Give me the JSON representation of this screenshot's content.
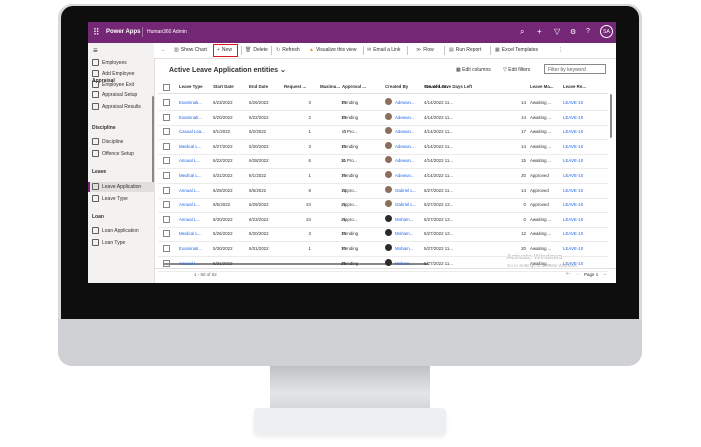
{
  "topbar": {
    "app_name": "Power Apps",
    "environment": "Human360 Admin",
    "avatar_initials": "SA",
    "icons": [
      "waffle-icon",
      "search-icon",
      "plus-icon",
      "filter-icon",
      "settings-icon",
      "help-icon"
    ]
  },
  "sidebar": {
    "groups": [
      {
        "items": [
          "Employees",
          "Add Employee",
          "Employee Exit"
        ]
      },
      {
        "heading": "Appraisal",
        "items": [
          "Appraisal Setup",
          "Appraisal Results"
        ]
      },
      {
        "heading": "Discipline",
        "items": [
          "Discipline",
          "Offence Setup"
        ]
      },
      {
        "heading": "Leave",
        "items": [
          "Leave Application",
          "Leave Type"
        ]
      },
      {
        "heading": "Loan",
        "items": [
          "Loan Application",
          "Loan Type"
        ]
      }
    ],
    "active_item": "Leave Application"
  },
  "commandbar": {
    "back": "←",
    "show_chart": "Show Chart",
    "new": "New",
    "delete": "Delete",
    "refresh": "Refresh",
    "visualize": "Visualize this view",
    "email_link": "Email a Link",
    "flow": "Flow",
    "run_report": "Run Report",
    "excel_templates": "Excel Templates",
    "more": "⋮"
  },
  "view": {
    "title": "Active Leave Application entities",
    "edit_columns": "Edit columns",
    "edit_filters": "Edit filters",
    "filter_placeholder": "Filter by keyword"
  },
  "grid": {
    "headers": [
      "Leave Type",
      "Start Date",
      "End Date",
      "Request ...",
      "Maximu...",
      "Approval ...",
      "Created By",
      "Created On",
      "No. of Leave Days Left",
      "Leave Ma...",
      "Leave Re..."
    ],
    "rows": [
      [
        "Examinati...",
        "5/23/2022",
        "5/26/2022",
        "3",
        "10",
        "Pending",
        "Adewun...",
        "4/14/2022 11...",
        "14",
        "Awaiting ...",
        "LEAVE-10"
      ],
      [
        "Examinati...",
        "5/20/2022",
        "5/22/2022",
        "2",
        "10",
        "Pending",
        "Adewun...",
        "4/14/2022 11...",
        "14",
        "Awaiting ...",
        "LEAVE-10"
      ],
      [
        "Casual Lea...",
        "6/1/2022",
        "6/2/2022",
        "1",
        "3",
        "In Pro...",
        "Adewun...",
        "4/14/2022 11...",
        "17",
        "Awaiting ...",
        "LEAVE-10"
      ],
      [
        "Medical L...",
        "5/27/2022",
        "5/30/2022",
        "3",
        "15",
        "Pending",
        "Adewun...",
        "4/14/2022 11...",
        "14",
        "Awaiting ...",
        "LEAVE-10"
      ],
      [
        "Annual L...",
        "6/22/2022",
        "6/28/2022",
        "6",
        "21",
        "In Pro...",
        "Adewun...",
        "4/14/2022 11...",
        "15",
        "Awaiting ...",
        "LEAVE-10"
      ],
      [
        "Medical L...",
        "5/31/2022",
        "6/1/2022",
        "1",
        "15",
        "Pending",
        "Adewun...",
        "4/14/2022 11...",
        "20",
        "Approved",
        "LEAVE-10"
      ],
      [
        "Annual L...",
        "5/29/2022",
        "6/6/2022",
        "8",
        "15",
        "Appro...",
        "Gabriel L...",
        "5/27/2022 11...",
        "14",
        "Approved",
        "LEAVE-10"
      ],
      [
        "Annual L...",
        "6/5/2022",
        "6/29/2022",
        "24",
        "21",
        "Appro...",
        "Gabriel L...",
        "5/27/2022 12...",
        "0",
        "Approved",
        "LEAVE-10"
      ],
      [
        "Annual L...",
        "5/30/2022",
        "6/23/2022",
        "24",
        "21",
        "Appro...",
        "Moham...",
        "5/27/2022 12...",
        "0",
        "Awaiting ...",
        "LEAVE-10"
      ],
      [
        "Medical L...",
        "5/26/2022",
        "5/30/2022",
        "3",
        "15",
        "Pending",
        "Moham...",
        "5/27/2022 12...",
        "12",
        "Awaiting ...",
        "LEAVE-10"
      ],
      [
        "Examinati...",
        "5/30/2022",
        "5/31/2022",
        "1",
        "10",
        "Pending",
        "Moham...",
        "5/27/2022 11...",
        "20",
        "Awaiting ...",
        "LEAVE-10"
      ],
      [
        "Annual L...",
        "5/31/2022",
        "",
        "",
        "21",
        "Pending",
        "Moham...",
        "5/27/2022 11...",
        "",
        "Awaiting ...",
        "LEAVE-10"
      ]
    ]
  },
  "footer": {
    "record_count": "1 - 50 of 52",
    "page_label": "Page 1"
  },
  "watermark": {
    "line1": "Activate Windows",
    "line2": "Go to Settings to activate Windows."
  }
}
